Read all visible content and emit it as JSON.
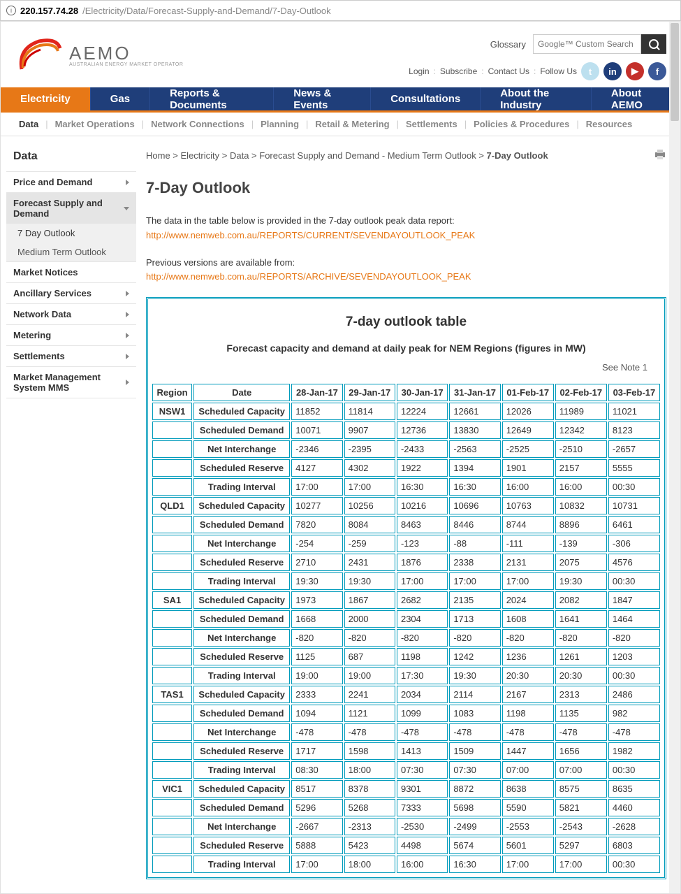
{
  "url": {
    "host": "220.157.74.28",
    "path": "/Electricity/Data/Forecast-Supply-and-Demand/7-Day-Outlook"
  },
  "header": {
    "brand_text": "AEMO",
    "brand_sub": "AUSTRALIAN ENERGY MARKET OPERATOR",
    "glossary": "Glossary",
    "search_placeholder": "Google™ Custom Search",
    "login": "Login",
    "subscribe": "Subscribe",
    "contact": "Contact Us",
    "follow": "Follow Us"
  },
  "mainnav": [
    "Electricity",
    "Gas",
    "Reports & Documents",
    "News & Events",
    "Consultations",
    "About the Industry",
    "About AEMO"
  ],
  "subnav": [
    "Data",
    "Market Operations",
    "Network Connections",
    "Planning",
    "Retail & Metering",
    "Settlements",
    "Policies & Procedures",
    "Resources"
  ],
  "side": {
    "title": "Data",
    "items": [
      {
        "label": "Price and Demand",
        "arrow": true
      },
      {
        "label": "Forecast Supply and Demand",
        "arrow": true,
        "expanded": true,
        "children": [
          {
            "label": "7 Day Outlook",
            "active": true
          },
          {
            "label": "Medium Term Outlook"
          }
        ]
      },
      {
        "label": "Market Notices"
      },
      {
        "label": "Ancillary Services",
        "arrow": true
      },
      {
        "label": "Network Data",
        "arrow": true
      },
      {
        "label": "Metering",
        "arrow": true
      },
      {
        "label": " Settlements",
        "arrow": true
      },
      {
        "label": "Market Management System MMS",
        "arrow": true
      }
    ]
  },
  "breadcrumbs": {
    "parts": [
      "Home",
      "Electricity",
      "Data",
      "Forecast Supply and Demand - Medium Term Outlook"
    ],
    "current": "7-Day Outlook"
  },
  "page": {
    "title": "7-Day Outlook",
    "intro1": "The data in the table below is provided in the 7-day outlook peak data report:",
    "link1": "http://www.nemweb.com.au/REPORTS/CURRENT/SEVENDAYOUTLOOK_PEAK",
    "intro2": "Previous versions are available from:",
    "link2": "http://www.nemweb.com.au/REPORTS/ARCHIVE/SEVENDAYOUTLOOK_PEAK"
  },
  "table": {
    "title": "7-day outlook table",
    "subtitle": "Forecast capacity and demand at daily peak for NEM Regions (figures in MW)",
    "note": "See Note 1",
    "headers": [
      "Region",
      "Date",
      "28-Jan-17",
      "29-Jan-17",
      "30-Jan-17",
      "31-Jan-17",
      "01-Feb-17",
      "02-Feb-17",
      "03-Feb-17"
    ],
    "row_labels": [
      "Scheduled Capacity",
      "Scheduled Demand",
      "Net Interchange",
      "Scheduled Reserve",
      "Trading Interval"
    ],
    "regions": [
      {
        "name": "NSW1",
        "rows": [
          [
            "11852",
            "11814",
            "12224",
            "12661",
            "12026",
            "11989",
            "11021"
          ],
          [
            "10071",
            "9907",
            "12736",
            "13830",
            "12649",
            "12342",
            "8123"
          ],
          [
            "-2346",
            "-2395",
            "-2433",
            "-2563",
            "-2525",
            "-2510",
            "-2657"
          ],
          [
            "4127",
            "4302",
            "1922",
            "1394",
            "1901",
            "2157",
            "5555"
          ],
          [
            "17:00",
            "17:00",
            "16:30",
            "16:30",
            "16:00",
            "16:00",
            "00:30"
          ]
        ]
      },
      {
        "name": "QLD1",
        "rows": [
          [
            "10277",
            "10256",
            "10216",
            "10696",
            "10763",
            "10832",
            "10731"
          ],
          [
            "7820",
            "8084",
            "8463",
            "8446",
            "8744",
            "8896",
            "6461"
          ],
          [
            "-254",
            "-259",
            "-123",
            "-88",
            "-111",
            "-139",
            "-306"
          ],
          [
            "2710",
            "2431",
            "1876",
            "2338",
            "2131",
            "2075",
            "4576"
          ],
          [
            "19:30",
            "19:30",
            "17:00",
            "17:00",
            "17:00",
            "19:30",
            "00:30"
          ]
        ]
      },
      {
        "name": "SA1",
        "rows": [
          [
            "1973",
            "1867",
            "2682",
            "2135",
            "2024",
            "2082",
            "1847"
          ],
          [
            "1668",
            "2000",
            "2304",
            "1713",
            "1608",
            "1641",
            "1464"
          ],
          [
            "-820",
            "-820",
            "-820",
            "-820",
            "-820",
            "-820",
            "-820"
          ],
          [
            "1125",
            "687",
            "1198",
            "1242",
            "1236",
            "1261",
            "1203"
          ],
          [
            "19:00",
            "19:00",
            "17:30",
            "19:30",
            "20:30",
            "20:30",
            "00:30"
          ]
        ]
      },
      {
        "name": "TAS1",
        "rows": [
          [
            "2333",
            "2241",
            "2034",
            "2114",
            "2167",
            "2313",
            "2486"
          ],
          [
            "1094",
            "1121",
            "1099",
            "1083",
            "1198",
            "1135",
            "982"
          ],
          [
            "-478",
            "-478",
            "-478",
            "-478",
            "-478",
            "-478",
            "-478"
          ],
          [
            "1717",
            "1598",
            "1413",
            "1509",
            "1447",
            "1656",
            "1982"
          ],
          [
            "08:30",
            "18:00",
            "07:30",
            "07:30",
            "07:00",
            "07:00",
            "00:30"
          ]
        ]
      },
      {
        "name": "VIC1",
        "rows": [
          [
            "8517",
            "8378",
            "9301",
            "8872",
            "8638",
            "8575",
            "8635"
          ],
          [
            "5296",
            "5268",
            "7333",
            "5698",
            "5590",
            "5821",
            "4460"
          ],
          [
            "-2667",
            "-2313",
            "-2530",
            "-2499",
            "-2553",
            "-2543",
            "-2628"
          ],
          [
            "5888",
            "5423",
            "4498",
            "5674",
            "5601",
            "5297",
            "6803"
          ],
          [
            "17:00",
            "18:00",
            "16:00",
            "16:30",
            "17:00",
            "17:00",
            "00:30"
          ]
        ]
      }
    ]
  }
}
